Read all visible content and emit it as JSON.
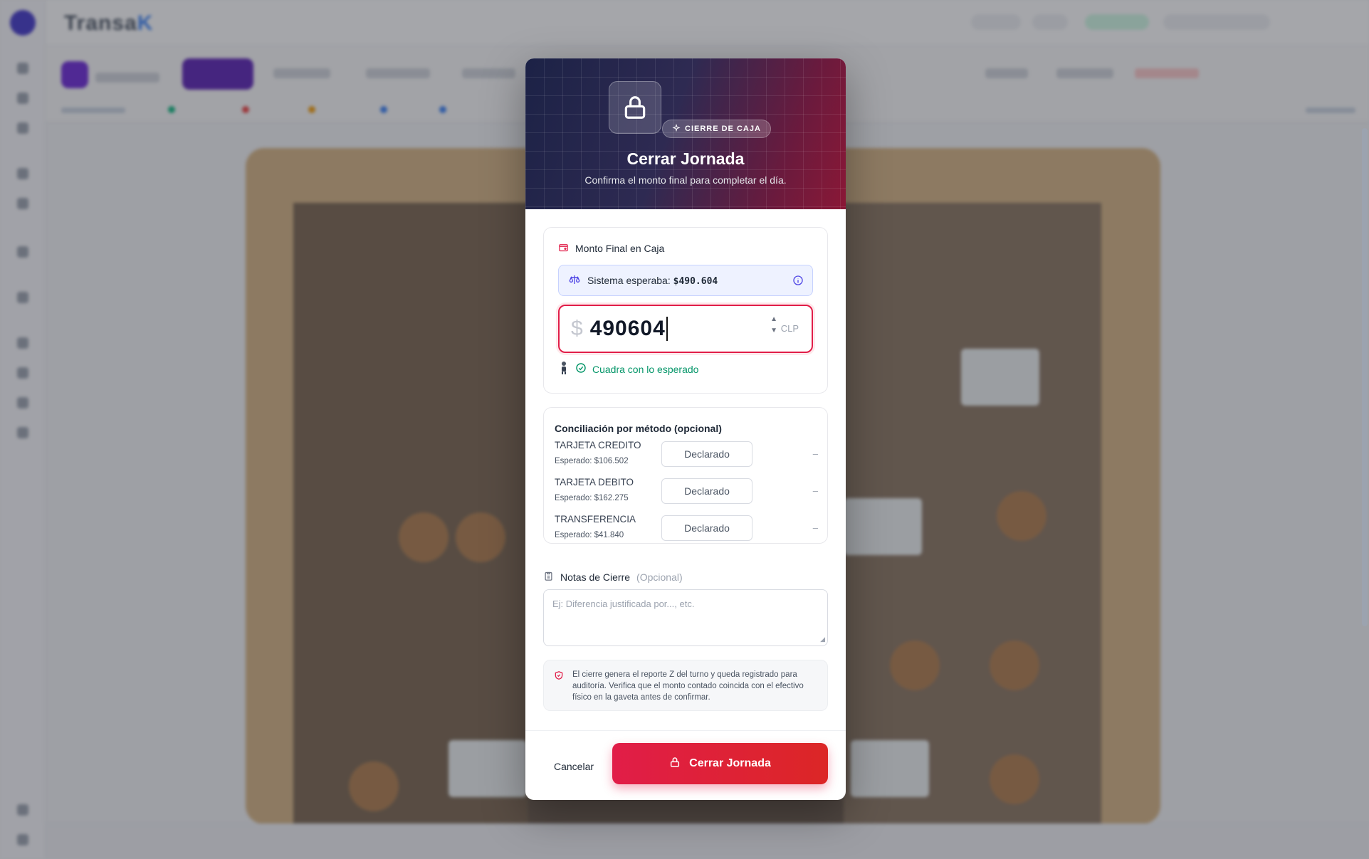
{
  "background": {
    "brand_prefix": "Transa",
    "brand_suffix": "K"
  },
  "modal": {
    "badge": "CIERRE DE CAJA",
    "title": "Cerrar Jornada",
    "subtitle": "Confirma el monto final para completar el día.",
    "amount_section": {
      "label": "Monto Final en Caja",
      "expected_label": "Sistema esperaba:",
      "expected_value": "$490.604",
      "currency_symbol": "$",
      "input_value": "490604",
      "currency_code": "CLP",
      "status": "Cuadra con lo esperado"
    },
    "reconciliation": {
      "title": "Conciliación por método (opcional)",
      "rows": [
        {
          "method": "TARJETA CREDITO",
          "expected": "Esperado: $106.502",
          "placeholder": "Declarado",
          "difference": "–"
        },
        {
          "method": "TARJETA DEBITO",
          "expected": "Esperado: $162.275",
          "placeholder": "Declarado",
          "difference": "–"
        },
        {
          "method": "TRANSFERENCIA",
          "expected": "Esperado: $41.840",
          "placeholder": "Declarado",
          "difference": "–"
        }
      ]
    },
    "notes": {
      "label": "Notas de Cierre",
      "optional": "(Opcional)",
      "placeholder": "Ej: Diferencia justificada por..., etc."
    },
    "warning": "El cierre genera el reporte Z del turno y queda registrado para auditoría. Verifica que el monto contado coincida con el efectivo físico en la gaveta antes de confirmar.",
    "cancel_label": "Cancelar",
    "confirm_label": "Cerrar Jornada"
  },
  "colors": {
    "accent": "#e11d48",
    "success": "#059669",
    "info_bg": "#eef2ff"
  }
}
